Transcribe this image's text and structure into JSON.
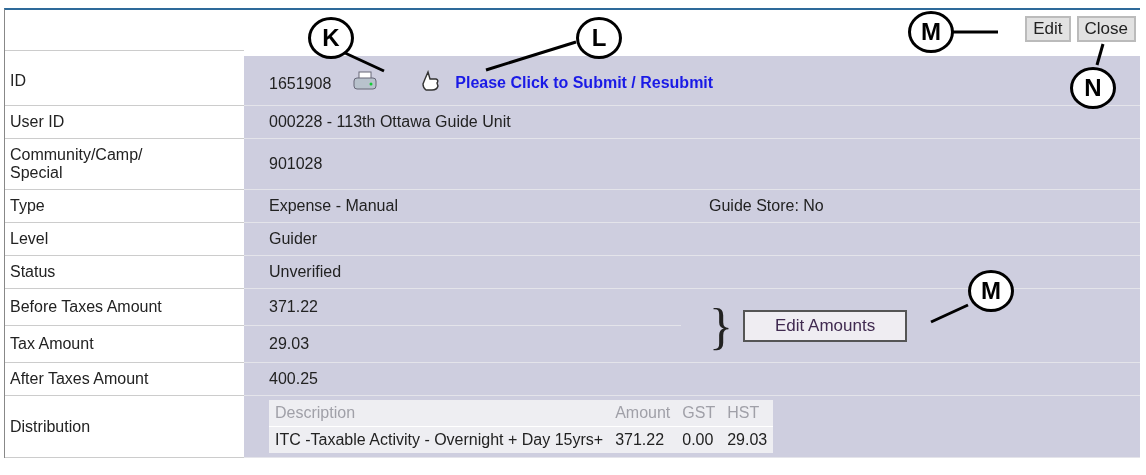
{
  "toolbar": {
    "buttons": [
      "Edit",
      "Close"
    ]
  },
  "fields": [
    {
      "kind": "id",
      "label": "ID",
      "value": "1651908",
      "link": "Please Click to Submit / Resubmit"
    },
    {
      "kind": "text",
      "label": "User ID",
      "value": "000228 - 113th Ottawa Guide Unit"
    },
    {
      "kind": "text",
      "label": "Community/Camp/\nSpecial",
      "value": "901028"
    },
    {
      "kind": "pair",
      "label": "Type",
      "value": "Expense - Manual",
      "extra": "Guide Store: No"
    },
    {
      "kind": "text",
      "label": "Level",
      "value": "Guider"
    },
    {
      "kind": "text",
      "label": "Status",
      "value": "Unverified"
    },
    {
      "kind": "amount",
      "label": "Before Taxes Amount",
      "value": "371.22",
      "brace": "}",
      "button": "Edit Amounts"
    },
    {
      "kind": "amount",
      "label": "Tax Amount",
      "value": "29.03"
    },
    {
      "kind": "text",
      "label": "After Taxes Amount",
      "value": "400.25"
    },
    {
      "kind": "table",
      "label": "Distribution",
      "columns": [
        "Description",
        "Amount",
        "GST",
        "HST"
      ],
      "rows": [
        [
          "ITC -Taxable Activity - Overnight + Day 15yrs+",
          "371.22",
          "0.00",
          "29.03"
        ]
      ]
    }
  ],
  "callouts": [
    {
      "letter": "K"
    },
    {
      "letter": "L"
    },
    {
      "letter": "M"
    },
    {
      "letter": "N"
    },
    {
      "letter": "M"
    }
  ]
}
